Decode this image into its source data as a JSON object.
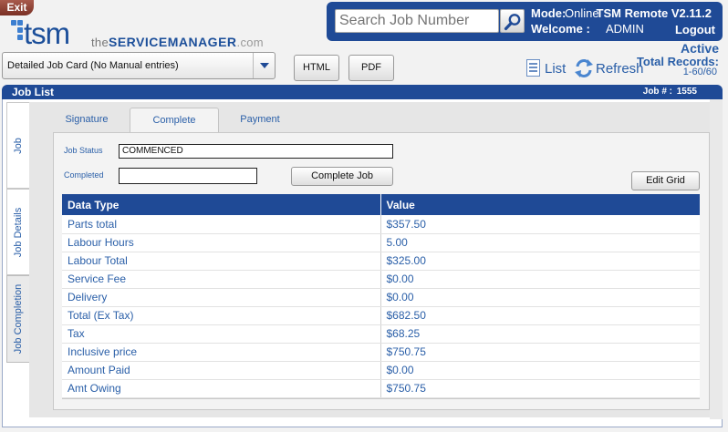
{
  "header": {
    "exit_label": "Exit",
    "logo_main": "tsm",
    "logo_prefix": "the",
    "logo_brand": "SERVICEMANAGER",
    "logo_domain": ".com",
    "search_placeholder": "Search Job Number",
    "mode_label": "Mode:",
    "mode_value": "Online",
    "welcome_label": "Welcome :",
    "welcome_value": "ADMIN",
    "version": "TSM Remote V2.11.2",
    "logout_label": "Logout"
  },
  "toolbar": {
    "report_selected": "Detailed Job Card (No Manual entries)",
    "html_label": "HTML",
    "pdf_label": "PDF",
    "list_label": "List",
    "refresh_label": "Refresh",
    "status": "Active",
    "total_records_label": "Total Records:",
    "records_count": "1-60/60"
  },
  "joblist": {
    "title": "Job List",
    "job_number_label": "Job # :",
    "job_number": "1555"
  },
  "side_tabs": [
    {
      "label": "Job"
    },
    {
      "label": "Job Details"
    },
    {
      "label": "Job Completion"
    }
  ],
  "tabs": [
    {
      "label": "Signature"
    },
    {
      "label": "Complete"
    },
    {
      "label": "Payment"
    }
  ],
  "form": {
    "job_status_label": "Job Status",
    "job_status_value": "COMMENCED",
    "completed_label": "Completed",
    "completed_value": "",
    "complete_job_label": "Complete Job",
    "edit_grid_label": "Edit Grid"
  },
  "grid": {
    "columns": [
      "Data Type",
      "Value"
    ],
    "rows": [
      [
        "Parts total",
        "$357.50"
      ],
      [
        "Labour Hours",
        "5.00"
      ],
      [
        "Labour Total",
        "$325.00"
      ],
      [
        "Service Fee",
        "$0.00"
      ],
      [
        "Delivery",
        "$0.00"
      ],
      [
        "Total (Ex Tax)",
        "$682.50"
      ],
      [
        "Tax",
        "$68.25"
      ],
      [
        "Inclusive price",
        "$750.75"
      ],
      [
        "Amount Paid",
        "$0.00"
      ],
      [
        "Amt Owing",
        "$750.75"
      ]
    ]
  },
  "colors": {
    "brand_blue": "#1f4a96",
    "link_blue": "#2a5fa8",
    "exit_red": "#8c3a2c"
  }
}
